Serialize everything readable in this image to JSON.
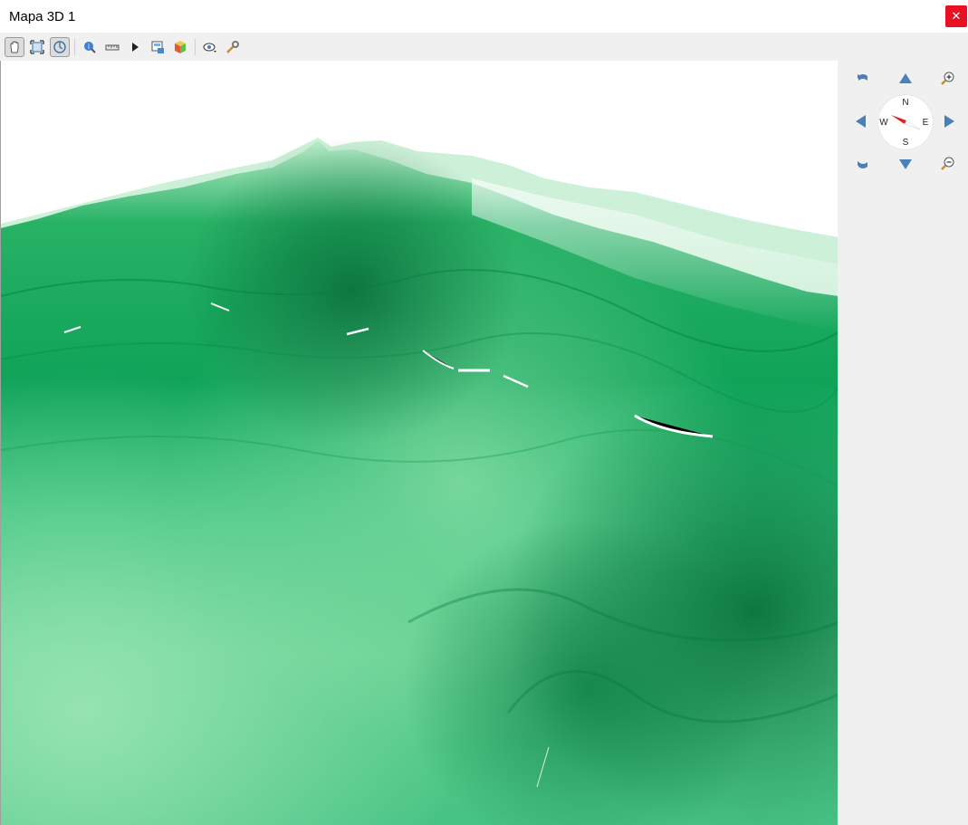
{
  "window": {
    "title": "Mapa 3D 1",
    "close_glyph": "✕"
  },
  "toolbar": {
    "buttons": [
      {
        "name": "pan-hand-icon",
        "active": true
      },
      {
        "name": "zoom-full-icon",
        "active": false
      },
      {
        "name": "camera-orbit-icon",
        "active": true
      },
      {
        "name": "identify-icon",
        "active": false
      },
      {
        "name": "measure-icon",
        "active": false
      },
      {
        "name": "animation-play-icon",
        "active": false
      },
      {
        "name": "export-image-icon",
        "active": false
      },
      {
        "name": "scene-3d-icon",
        "active": false
      },
      {
        "name": "view-options-icon",
        "active": false
      },
      {
        "name": "settings-wrench-icon",
        "active": false
      }
    ]
  },
  "navigation": {
    "compass": {
      "north": "N",
      "south": "S",
      "east": "E",
      "west": "W"
    },
    "colors": {
      "arrow": "#4b7fb8",
      "needle_red": "#e02020",
      "needle_white": "#ffffff"
    }
  },
  "terrain": {
    "colors": {
      "dark": "#007a3d",
      "mid": "#1fb86a",
      "light": "#8fe0aa",
      "sky": "#ffffff"
    }
  }
}
